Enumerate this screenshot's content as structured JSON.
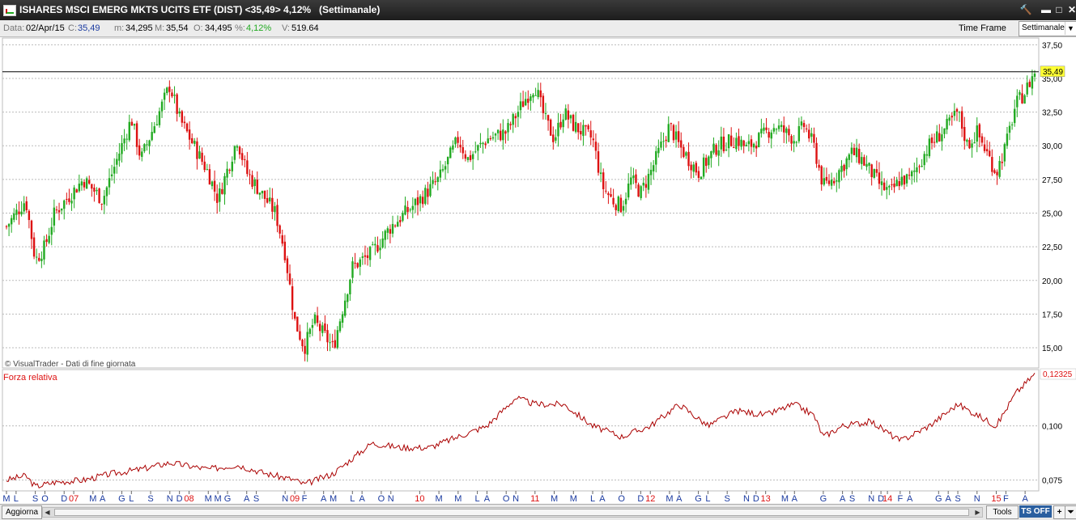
{
  "window": {
    "title": "ISHARES MSCI EMERG MKTS UCITS ETF (DIST) <35,49> 4,12%",
    "period": "(Settimanale)",
    "buttons": {
      "tool": "🔨",
      "minimize": "▬",
      "maximize": "□",
      "close": "✕"
    }
  },
  "infobar": {
    "date_label": "Data:",
    "date": "02/Apr/15",
    "close_label": "C:",
    "close": "35,49",
    "min_label": "m:",
    "min": "34,295",
    "max_label": "M:",
    "max": "35,54",
    "open_label": "O:",
    "open": "34,495",
    "pct_label": "%:",
    "pct": "4,12%",
    "vol_label": "V:",
    "vol": "519.64",
    "timeframe_label": "Time Frame",
    "timeframe_value": "Settimanale"
  },
  "colors": {
    "up": "#22aa22",
    "down": "#dd1111",
    "grid": "#bbbbbb",
    "rs_line": "#aa0000",
    "price_badge": "#ffff33"
  },
  "chart_data": [
    {
      "type": "candlestick",
      "title": "",
      "watermark": "© VisualTrader - Dati di fine giornata",
      "last_value_label": "35,49",
      "ylim": [
        13.5,
        38
      ],
      "yticks": [
        15.0,
        17.5,
        20.0,
        22.5,
        25.0,
        27.5,
        30.0,
        32.5,
        35.0,
        37.5
      ],
      "ytick_labels": [
        "15,00",
        "17,50",
        "20,00",
        "22,50",
        "25,00",
        "27,50",
        "30,00",
        "32,50",
        "35,00",
        "37,50"
      ],
      "x_range": [
        "2007-05",
        "2015-04"
      ],
      "anchors": [
        {
          "x": "2007-05",
          "close": 24.0
        },
        {
          "x": "2007-07",
          "close": 26.0
        },
        {
          "x": "2007-08",
          "close": 21.5
        },
        {
          "x": "2007-09",
          "close": 22.5
        },
        {
          "x": "2007-10",
          "close": 25.0
        },
        {
          "x": "2008-01",
          "close": 27.5
        },
        {
          "x": "2008-03",
          "close": 26.0
        },
        {
          "x": "2008-05",
          "close": 30.0
        },
        {
          "x": "2008-06",
          "close": 32.0
        },
        {
          "x": "2008-07",
          "close": 29.0
        },
        {
          "x": "2008-10",
          "close": 34.5
        },
        {
          "x": "2008-11",
          "close": 32.0
        },
        {
          "x": "2009-02",
          "close": 28.0
        },
        {
          "x": "2009-03",
          "close": 26.0
        },
        {
          "x": "2009-05",
          "close": 30.5
        },
        {
          "x": "2009-06",
          "close": 28.0
        },
        {
          "x": "2009-09",
          "close": 25.0
        },
        {
          "x": "2009-10",
          "close": 22.0
        },
        {
          "x": "2009-11",
          "close": 17.0
        },
        {
          "x": "2009-12",
          "close": 15.0
        },
        {
          "x": "2010-01",
          "close": 17.0
        },
        {
          "x": "2010-03",
          "close": 15.0
        },
        {
          "x": "2010-04",
          "close": 18.0
        },
        {
          "x": "2010-05",
          "close": 21.0
        },
        {
          "x": "2010-07",
          "close": 22.0
        },
        {
          "x": "2010-09",
          "close": 24.0
        },
        {
          "x": "2010-12",
          "close": 26.0
        },
        {
          "x": "2011-02",
          "close": 27.5
        },
        {
          "x": "2011-04",
          "close": 30.5
        },
        {
          "x": "2011-05",
          "close": 29.0
        },
        {
          "x": "2011-07",
          "close": 30.5
        },
        {
          "x": "2011-09",
          "close": 31.0
        },
        {
          "x": "2011-11",
          "close": 33.5
        },
        {
          "x": "2011-12",
          "close": 34.5
        },
        {
          "x": "2012-01",
          "close": 32.0
        },
        {
          "x": "2012-02",
          "close": 30.5
        },
        {
          "x": "2012-03",
          "close": 32.5
        },
        {
          "x": "2012-04",
          "close": 31.5
        },
        {
          "x": "2012-06",
          "close": 30.5
        },
        {
          "x": "2012-07",
          "close": 27.0
        },
        {
          "x": "2012-08",
          "close": 26.0
        },
        {
          "x": "2012-09",
          "close": 25.5
        },
        {
          "x": "2012-10",
          "close": 27.5
        },
        {
          "x": "2012-11",
          "close": 26.5
        },
        {
          "x": "2012-12",
          "close": 28.0
        },
        {
          "x": "2013-02",
          "close": 31.5
        },
        {
          "x": "2013-03",
          "close": 30.0
        },
        {
          "x": "2013-05",
          "close": 28.0
        },
        {
          "x": "2013-07",
          "close": 30.0
        },
        {
          "x": "2013-09",
          "close": 30.5
        },
        {
          "x": "2013-10",
          "close": 29.8
        },
        {
          "x": "2014-01",
          "close": 31.5
        },
        {
          "x": "2014-03",
          "close": 30.5
        },
        {
          "x": "2014-04",
          "close": 31.5
        },
        {
          "x": "2014-05",
          "close": 30.0
        },
        {
          "x": "2014-06",
          "close": 27.0
        },
        {
          "x": "2014-07",
          "close": 27.5
        },
        {
          "x": "2014-09",
          "close": 29.5
        },
        {
          "x": "2014-10",
          "close": 29.0
        },
        {
          "x": "2014-12",
          "close": 27.0
        },
        {
          "x": "2015-01",
          "close": 26.5
        },
        {
          "x": "2015-02",
          "close": 27.5
        },
        {
          "x": "2015-03",
          "close": 27.5
        },
        {
          "x": "2015-05",
          "close": 30.0
        },
        {
          "x": "2015-07",
          "close": 31.5
        },
        {
          "x": "2015-08",
          "close": 32.5
        },
        {
          "x": "2015-09",
          "close": 30.0
        },
        {
          "x": "2015-10",
          "close": 31.0
        },
        {
          "x": "2015-11",
          "close": 29.5
        },
        {
          "x": "2015-12",
          "close": 28.0
        },
        {
          "x": "2016-01",
          "close": 30.0
        },
        {
          "x": "2016-02",
          "close": 33.0
        },
        {
          "x": "2016-03",
          "close": 34.0
        },
        {
          "x": "2016-04",
          "close": 35.49
        }
      ]
    },
    {
      "type": "line",
      "series": [
        {
          "name": "Forza relativa"
        }
      ],
      "last_value_label": "0,12325",
      "ylim": [
        0.07,
        0.126
      ],
      "yticks": [
        0.075,
        0.1
      ],
      "ytick_labels": [
        "0,075",
        "0,100"
      ],
      "anchors": [
        {
          "x": "2007-05",
          "y": 0.075
        },
        {
          "x": "2007-07",
          "y": 0.077
        },
        {
          "x": "2007-08",
          "y": 0.072
        },
        {
          "x": "2007-10",
          "y": 0.074
        },
        {
          "x": "2008-01",
          "y": 0.075
        },
        {
          "x": "2008-04",
          "y": 0.078
        },
        {
          "x": "2008-07",
          "y": 0.08
        },
        {
          "x": "2008-10",
          "y": 0.083
        },
        {
          "x": "2009-02",
          "y": 0.08
        },
        {
          "x": "2009-05",
          "y": 0.082
        },
        {
          "x": "2009-08",
          "y": 0.078
        },
        {
          "x": "2009-11",
          "y": 0.075
        },
        {
          "x": "2009-12",
          "y": 0.073
        },
        {
          "x": "2010-03",
          "y": 0.078
        },
        {
          "x": "2010-05",
          "y": 0.085
        },
        {
          "x": "2010-07",
          "y": 0.092
        },
        {
          "x": "2010-10",
          "y": 0.09
        },
        {
          "x": "2011-01",
          "y": 0.09
        },
        {
          "x": "2011-04",
          "y": 0.095
        },
        {
          "x": "2011-07",
          "y": 0.1
        },
        {
          "x": "2011-10",
          "y": 0.113
        },
        {
          "x": "2011-12",
          "y": 0.11
        },
        {
          "x": "2012-03",
          "y": 0.11
        },
        {
          "x": "2012-06",
          "y": 0.1
        },
        {
          "x": "2012-09",
          "y": 0.095
        },
        {
          "x": "2012-12",
          "y": 0.1
        },
        {
          "x": "2013-03",
          "y": 0.11
        },
        {
          "x": "2013-06",
          "y": 0.1
        },
        {
          "x": "2013-09",
          "y": 0.107
        },
        {
          "x": "2013-12",
          "y": 0.105
        },
        {
          "x": "2014-03",
          "y": 0.11
        },
        {
          "x": "2014-05",
          "y": 0.105
        },
        {
          "x": "2014-06",
          "y": 0.095
        },
        {
          "x": "2014-08",
          "y": 0.1
        },
        {
          "x": "2014-11",
          "y": 0.102
        },
        {
          "x": "2015-02",
          "y": 0.093
        },
        {
          "x": "2015-05",
          "y": 0.1
        },
        {
          "x": "2015-08",
          "y": 0.11
        },
        {
          "x": "2015-10",
          "y": 0.105
        },
        {
          "x": "2015-12",
          "y": 0.1
        },
        {
          "x": "2016-02",
          "y": 0.115
        },
        {
          "x": "2016-04",
          "y": 0.124
        }
      ]
    }
  ],
  "x_axis": {
    "labels": [
      {
        "x": "2007-05",
        "t": "M",
        "year": false
      },
      {
        "x": "2007-06",
        "t": "L",
        "year": false
      },
      {
        "x": "2007-08",
        "t": "S",
        "year": false
      },
      {
        "x": "2007-09",
        "t": "O",
        "year": false
      },
      {
        "x": "2007-11",
        "t": "D",
        "year": false
      },
      {
        "x": "2007-12",
        "t": "07",
        "year": true
      },
      {
        "x": "2008-02",
        "t": "M",
        "year": false
      },
      {
        "x": "2008-03",
        "t": "A",
        "year": false
      },
      {
        "x": "2008-05",
        "t": "G",
        "year": false
      },
      {
        "x": "2008-06",
        "t": "L",
        "year": false
      },
      {
        "x": "2008-08",
        "t": "S",
        "year": false
      },
      {
        "x": "2008-10",
        "t": "N",
        "year": false
      },
      {
        "x": "2008-11",
        "t": "D",
        "year": false
      },
      {
        "x": "2008-12",
        "t": "08",
        "year": true
      },
      {
        "x": "2009-02",
        "t": "M",
        "year": false
      },
      {
        "x": "2009-03",
        "t": "M",
        "year": false
      },
      {
        "x": "2009-04",
        "t": "G",
        "year": false
      },
      {
        "x": "2009-06",
        "t": "A",
        "year": false
      },
      {
        "x": "2009-07",
        "t": "S",
        "year": false
      },
      {
        "x": "2009-10",
        "t": "N",
        "year": false
      },
      {
        "x": "2009-11",
        "t": "09",
        "year": true
      },
      {
        "x": "2009-12",
        "t": "F",
        "year": false
      },
      {
        "x": "2010-02",
        "t": "A",
        "year": false
      },
      {
        "x": "2010-03",
        "t": "M",
        "year": false
      },
      {
        "x": "2010-05",
        "t": "L",
        "year": false
      },
      {
        "x": "2010-06",
        "t": "A",
        "year": false
      },
      {
        "x": "2010-08",
        "t": "O",
        "year": false
      },
      {
        "x": "2010-09",
        "t": "N",
        "year": false
      },
      {
        "x": "2010-12",
        "t": "10",
        "year": true
      },
      {
        "x": "2011-02",
        "t": "M",
        "year": false
      },
      {
        "x": "2011-04",
        "t": "M",
        "year": false
      },
      {
        "x": "2011-06",
        "t": "L",
        "year": false
      },
      {
        "x": "2011-07",
        "t": "A",
        "year": false
      },
      {
        "x": "2011-09",
        "t": "O",
        "year": false
      },
      {
        "x": "2011-10",
        "t": "N",
        "year": false
      },
      {
        "x": "2011-12",
        "t": "11",
        "year": true
      },
      {
        "x": "2012-02",
        "t": "M",
        "year": false
      },
      {
        "x": "2012-04",
        "t": "M",
        "year": false
      },
      {
        "x": "2012-06",
        "t": "L",
        "year": false
      },
      {
        "x": "2012-07",
        "t": "A",
        "year": false
      },
      {
        "x": "2012-09",
        "t": "O",
        "year": false
      },
      {
        "x": "2012-11",
        "t": "D",
        "year": false
      },
      {
        "x": "2012-12",
        "t": "12",
        "year": true
      },
      {
        "x": "2013-02",
        "t": "M",
        "year": false
      },
      {
        "x": "2013-03",
        "t": "A",
        "year": false
      },
      {
        "x": "2013-05",
        "t": "G",
        "year": false
      },
      {
        "x": "2013-06",
        "t": "L",
        "year": false
      },
      {
        "x": "2013-08",
        "t": "S",
        "year": false
      },
      {
        "x": "2013-10",
        "t": "N",
        "year": false
      },
      {
        "x": "2013-11",
        "t": "D",
        "year": false
      },
      {
        "x": "2013-12",
        "t": "13",
        "year": true
      },
      {
        "x": "2014-02",
        "t": "M",
        "year": false
      },
      {
        "x": "2014-03",
        "t": "A",
        "year": false
      },
      {
        "x": "2014-06",
        "t": "G",
        "year": false
      },
      {
        "x": "2014-08",
        "t": "A",
        "year": false
      },
      {
        "x": "2014-09",
        "t": "S",
        "year": false
      },
      {
        "x": "2014-11",
        "t": "N",
        "year": false
      },
      {
        "x": "2014-12",
        "t": "D",
        "year": false
      },
      {
        "x": "2014-12b",
        "t": "14",
        "year": true
      },
      {
        "x": "2015-02",
        "t": "F",
        "year": false
      },
      {
        "x": "2015-03",
        "t": "A",
        "year": false
      },
      {
        "x": "2015-06",
        "t": "G",
        "year": false
      },
      {
        "x": "2015-07",
        "t": "A",
        "year": false
      },
      {
        "x": "2015-08",
        "t": "S",
        "year": false
      },
      {
        "x": "2015-10",
        "t": "N",
        "year": false
      },
      {
        "x": "2015-12",
        "t": "15",
        "year": true
      },
      {
        "x": "2016-01",
        "t": "F",
        "year": false
      },
      {
        "x": "2016-03",
        "t": "A",
        "year": false
      }
    ]
  },
  "bottombar": {
    "refresh": "Aggiorna",
    "tools": "Tools",
    "ts_off": "TS OFF",
    "plus": "+",
    "arrow": "⏷"
  }
}
